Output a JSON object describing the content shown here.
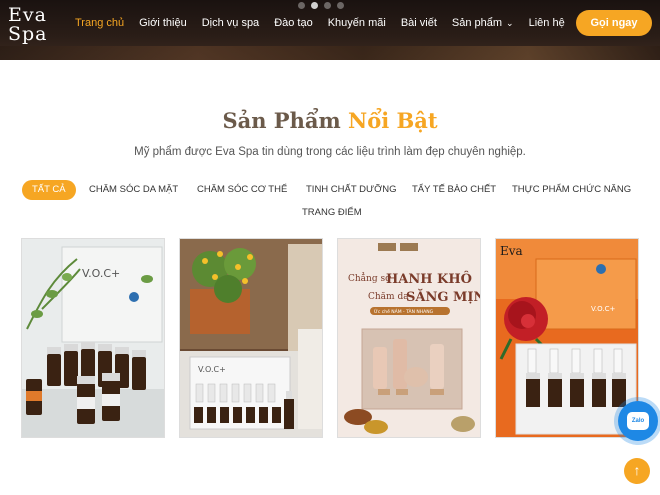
{
  "header": {
    "logo_line1": "Eva",
    "logo_line2": "Spa",
    "nav": [
      "Trang chủ",
      "Giới thiệu",
      "Dịch vụ spa",
      "Đào tạo",
      "Khuyến mãi",
      "Bài viết",
      "Sản phẩm",
      "Liên hệ"
    ],
    "active_nav": "Trang chủ",
    "cta_label": "Gọi ngay"
  },
  "section": {
    "title_part1": "Sản Phẩm",
    "title_part2": "Nổi Bật",
    "subtitle": "Mỹ phẩm được Eva Spa tin dùng trong các liệu trình làm đẹp chuyên nghiệp."
  },
  "filters": [
    "TẤT CẢ",
    "CHĂM SÓC DA MẶT",
    "CHĂM SÓC CƠ THỂ",
    "TINH CHẤT DƯỠNG",
    "TẨY TẾ BÀO CHẾT",
    "THỰC PHẨM CHỨC NĂNG",
    "TRANG ĐIỂM"
  ],
  "active_filter": "TẤT CẢ",
  "products": {
    "p1_brand": "V.O.C+",
    "p2_brand": "V.O.C+",
    "p3_line1": "Chẳng sợ",
    "p3_line2": "HANH KHÔ",
    "p3_line3": "Chăm da",
    "p3_line4": "SĂNG MỊN",
    "p3_tag": "Ức chế NÁM - TÀN NHANG",
    "p4_brand": "Eva",
    "p4_box": "V.O.C+"
  },
  "colors": {
    "accent": "#f6a623",
    "title_dark": "#6b5a4a",
    "zalo": "#1e88e5"
  },
  "icons": {
    "zalo": "zalo-chat-icon",
    "back_to_top": "arrow-up-icon",
    "dropdown": "chevron-down-icon"
  },
  "zalo_label": "Zalo"
}
